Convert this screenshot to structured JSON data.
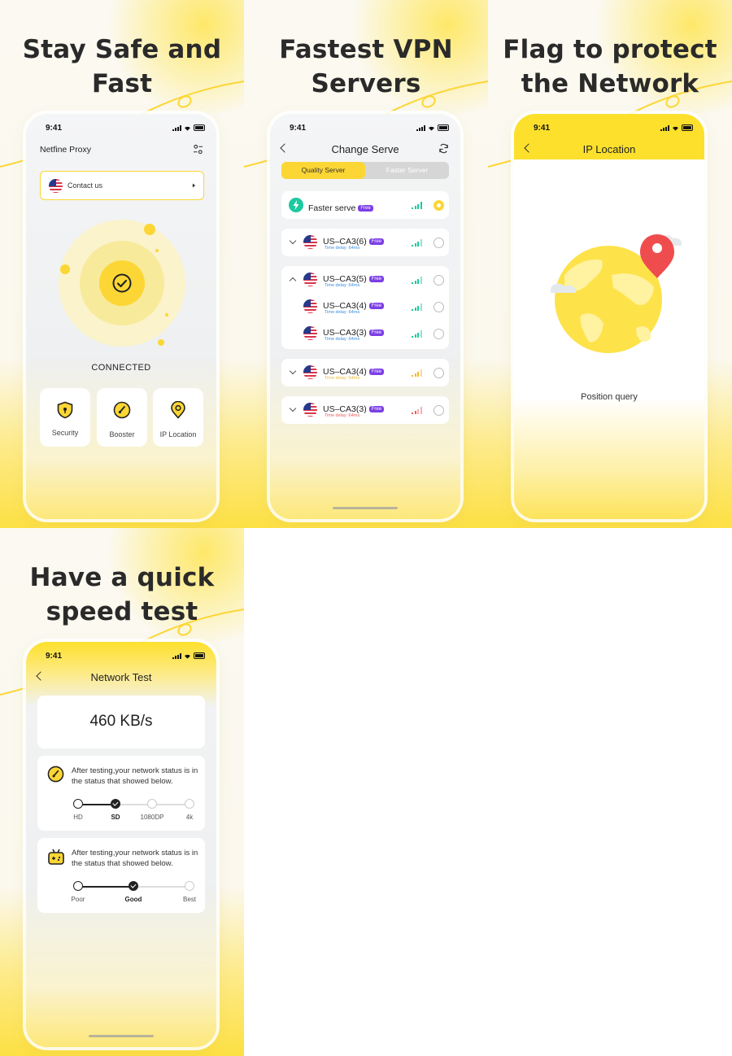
{
  "colors": {
    "accent": "#fcd634",
    "free_badge": "#7b3fe4",
    "signal_good": "#1cc9a0",
    "signal_mid": "#f5b82e",
    "signal_poor": "#ef5a5a"
  },
  "panel1": {
    "headline_line1": "Stay Safe and",
    "headline_line2": "Fast",
    "status_time": "9:41",
    "app_title": "Netfine Proxy",
    "contact_label": "Contact us",
    "status_label": "CONNECTED",
    "features": [
      {
        "label": "Security",
        "icon": "shield-icon"
      },
      {
        "label": "Booster",
        "icon": "speed-gauge-icon"
      },
      {
        "label": "IP Location",
        "icon": "location-pin-icon"
      }
    ]
  },
  "panel2": {
    "headline_line1": "Fastest VPN",
    "headline_line2": "Servers",
    "status_time": "9:41",
    "title": "Change Serve",
    "tabs": {
      "quality": "Quality Server",
      "faster": "Faster Server"
    },
    "faster_serve_label": "Faster serve",
    "free_badge": "Free",
    "delay_label": "Time delay :64ms",
    "servers": [
      {
        "name": "US–CA3(6)",
        "signal": "good",
        "expanded": false
      },
      {
        "name": "US–CA3(5)",
        "signal": "good",
        "expanded": true
      },
      {
        "name": "US–CA3(4)",
        "signal": "good",
        "child": true
      },
      {
        "name": "US–CA3(3)",
        "signal": "good",
        "child": true
      },
      {
        "name": "US–CA3(4)",
        "signal": "mid",
        "expanded": false
      },
      {
        "name": "US–CA3(3)",
        "signal": "poor",
        "expanded": false
      }
    ]
  },
  "panel3": {
    "headline_line1": "Flag to protect",
    "headline_line2": "the Network",
    "status_time": "9:41",
    "title": "IP Location",
    "position_query": "Position query"
  },
  "panel4": {
    "headline_line1": "Have a quick",
    "headline_line2": "speed test",
    "status_time": "9:41",
    "title": "Network Test",
    "speed": "460 KB/s",
    "message": "After testing,your network status is in the status that showed below.",
    "video_quality": {
      "options": [
        "HD",
        "SD",
        "1080DP",
        "4k"
      ],
      "selected": "SD"
    },
    "game_quality": {
      "options": [
        "Poor",
        "Good",
        "Best"
      ],
      "selected": "Good"
    }
  }
}
